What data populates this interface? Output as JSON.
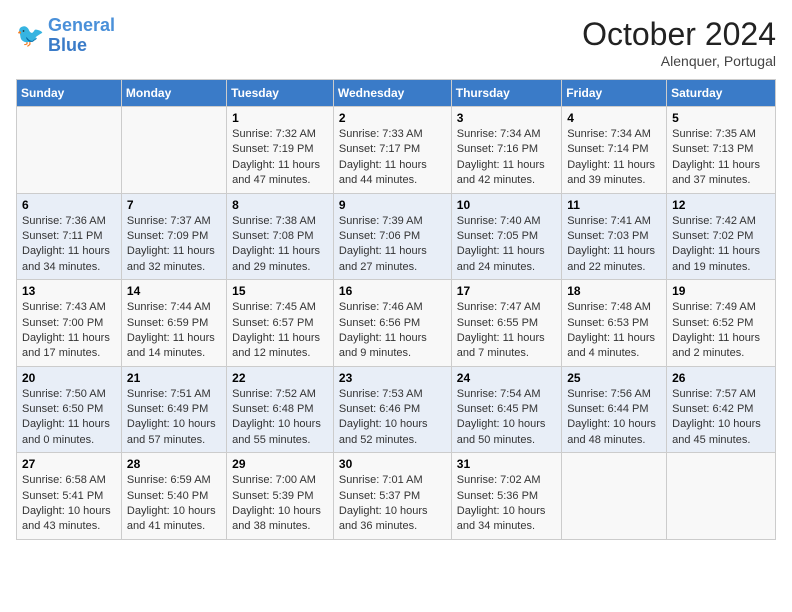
{
  "header": {
    "logo_line1": "General",
    "logo_line2": "Blue",
    "month": "October 2024",
    "location": "Alenquer, Portugal"
  },
  "days_of_week": [
    "Sunday",
    "Monday",
    "Tuesday",
    "Wednesday",
    "Thursday",
    "Friday",
    "Saturday"
  ],
  "weeks": [
    [
      {
        "day": "",
        "sunrise": "",
        "sunset": "",
        "daylight": ""
      },
      {
        "day": "",
        "sunrise": "",
        "sunset": "",
        "daylight": ""
      },
      {
        "day": "1",
        "sunrise": "Sunrise: 7:32 AM",
        "sunset": "Sunset: 7:19 PM",
        "daylight": "Daylight: 11 hours and 47 minutes."
      },
      {
        "day": "2",
        "sunrise": "Sunrise: 7:33 AM",
        "sunset": "Sunset: 7:17 PM",
        "daylight": "Daylight: 11 hours and 44 minutes."
      },
      {
        "day": "3",
        "sunrise": "Sunrise: 7:34 AM",
        "sunset": "Sunset: 7:16 PM",
        "daylight": "Daylight: 11 hours and 42 minutes."
      },
      {
        "day": "4",
        "sunrise": "Sunrise: 7:34 AM",
        "sunset": "Sunset: 7:14 PM",
        "daylight": "Daylight: 11 hours and 39 minutes."
      },
      {
        "day": "5",
        "sunrise": "Sunrise: 7:35 AM",
        "sunset": "Sunset: 7:13 PM",
        "daylight": "Daylight: 11 hours and 37 minutes."
      }
    ],
    [
      {
        "day": "6",
        "sunrise": "Sunrise: 7:36 AM",
        "sunset": "Sunset: 7:11 PM",
        "daylight": "Daylight: 11 hours and 34 minutes."
      },
      {
        "day": "7",
        "sunrise": "Sunrise: 7:37 AM",
        "sunset": "Sunset: 7:09 PM",
        "daylight": "Daylight: 11 hours and 32 minutes."
      },
      {
        "day": "8",
        "sunrise": "Sunrise: 7:38 AM",
        "sunset": "Sunset: 7:08 PM",
        "daylight": "Daylight: 11 hours and 29 minutes."
      },
      {
        "day": "9",
        "sunrise": "Sunrise: 7:39 AM",
        "sunset": "Sunset: 7:06 PM",
        "daylight": "Daylight: 11 hours and 27 minutes."
      },
      {
        "day": "10",
        "sunrise": "Sunrise: 7:40 AM",
        "sunset": "Sunset: 7:05 PM",
        "daylight": "Daylight: 11 hours and 24 minutes."
      },
      {
        "day": "11",
        "sunrise": "Sunrise: 7:41 AM",
        "sunset": "Sunset: 7:03 PM",
        "daylight": "Daylight: 11 hours and 22 minutes."
      },
      {
        "day": "12",
        "sunrise": "Sunrise: 7:42 AM",
        "sunset": "Sunset: 7:02 PM",
        "daylight": "Daylight: 11 hours and 19 minutes."
      }
    ],
    [
      {
        "day": "13",
        "sunrise": "Sunrise: 7:43 AM",
        "sunset": "Sunset: 7:00 PM",
        "daylight": "Daylight: 11 hours and 17 minutes."
      },
      {
        "day": "14",
        "sunrise": "Sunrise: 7:44 AM",
        "sunset": "Sunset: 6:59 PM",
        "daylight": "Daylight: 11 hours and 14 minutes."
      },
      {
        "day": "15",
        "sunrise": "Sunrise: 7:45 AM",
        "sunset": "Sunset: 6:57 PM",
        "daylight": "Daylight: 11 hours and 12 minutes."
      },
      {
        "day": "16",
        "sunrise": "Sunrise: 7:46 AM",
        "sunset": "Sunset: 6:56 PM",
        "daylight": "Daylight: 11 hours and 9 minutes."
      },
      {
        "day": "17",
        "sunrise": "Sunrise: 7:47 AM",
        "sunset": "Sunset: 6:55 PM",
        "daylight": "Daylight: 11 hours and 7 minutes."
      },
      {
        "day": "18",
        "sunrise": "Sunrise: 7:48 AM",
        "sunset": "Sunset: 6:53 PM",
        "daylight": "Daylight: 11 hours and 4 minutes."
      },
      {
        "day": "19",
        "sunrise": "Sunrise: 7:49 AM",
        "sunset": "Sunset: 6:52 PM",
        "daylight": "Daylight: 11 hours and 2 minutes."
      }
    ],
    [
      {
        "day": "20",
        "sunrise": "Sunrise: 7:50 AM",
        "sunset": "Sunset: 6:50 PM",
        "daylight": "Daylight: 11 hours and 0 minutes."
      },
      {
        "day": "21",
        "sunrise": "Sunrise: 7:51 AM",
        "sunset": "Sunset: 6:49 PM",
        "daylight": "Daylight: 10 hours and 57 minutes."
      },
      {
        "day": "22",
        "sunrise": "Sunrise: 7:52 AM",
        "sunset": "Sunset: 6:48 PM",
        "daylight": "Daylight: 10 hours and 55 minutes."
      },
      {
        "day": "23",
        "sunrise": "Sunrise: 7:53 AM",
        "sunset": "Sunset: 6:46 PM",
        "daylight": "Daylight: 10 hours and 52 minutes."
      },
      {
        "day": "24",
        "sunrise": "Sunrise: 7:54 AM",
        "sunset": "Sunset: 6:45 PM",
        "daylight": "Daylight: 10 hours and 50 minutes."
      },
      {
        "day": "25",
        "sunrise": "Sunrise: 7:56 AM",
        "sunset": "Sunset: 6:44 PM",
        "daylight": "Daylight: 10 hours and 48 minutes."
      },
      {
        "day": "26",
        "sunrise": "Sunrise: 7:57 AM",
        "sunset": "Sunset: 6:42 PM",
        "daylight": "Daylight: 10 hours and 45 minutes."
      }
    ],
    [
      {
        "day": "27",
        "sunrise": "Sunrise: 6:58 AM",
        "sunset": "Sunset: 5:41 PM",
        "daylight": "Daylight: 10 hours and 43 minutes."
      },
      {
        "day": "28",
        "sunrise": "Sunrise: 6:59 AM",
        "sunset": "Sunset: 5:40 PM",
        "daylight": "Daylight: 10 hours and 41 minutes."
      },
      {
        "day": "29",
        "sunrise": "Sunrise: 7:00 AM",
        "sunset": "Sunset: 5:39 PM",
        "daylight": "Daylight: 10 hours and 38 minutes."
      },
      {
        "day": "30",
        "sunrise": "Sunrise: 7:01 AM",
        "sunset": "Sunset: 5:37 PM",
        "daylight": "Daylight: 10 hours and 36 minutes."
      },
      {
        "day": "31",
        "sunrise": "Sunrise: 7:02 AM",
        "sunset": "Sunset: 5:36 PM",
        "daylight": "Daylight: 10 hours and 34 minutes."
      },
      {
        "day": "",
        "sunrise": "",
        "sunset": "",
        "daylight": ""
      },
      {
        "day": "",
        "sunrise": "",
        "sunset": "",
        "daylight": ""
      }
    ]
  ]
}
